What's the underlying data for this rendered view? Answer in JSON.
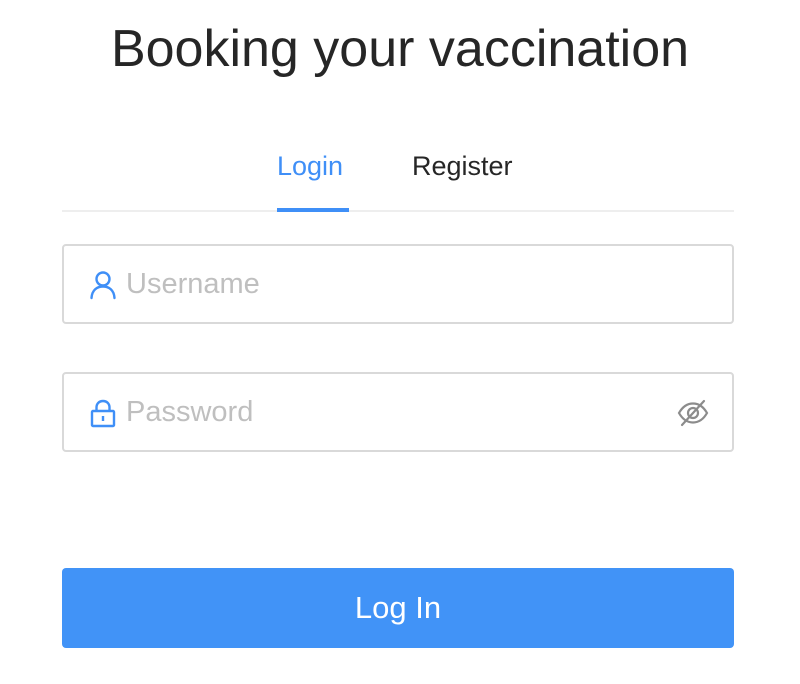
{
  "page": {
    "title": "Booking your vaccination"
  },
  "tabs": [
    {
      "label": "Login",
      "active": true
    },
    {
      "label": "Register",
      "active": false
    }
  ],
  "form": {
    "username": {
      "placeholder": "Username",
      "value": "",
      "icon": "user-icon"
    },
    "password": {
      "placeholder": "Password",
      "value": "",
      "icon": "lock-icon",
      "toggle_icon": "eye-invisible-icon"
    },
    "submit_label": "Log In"
  },
  "colors": {
    "accent": "#3f8ff7",
    "button": "#4193f7",
    "text": "#262626",
    "placeholder": "#bfbfbf",
    "border": "#d9d9d9"
  }
}
